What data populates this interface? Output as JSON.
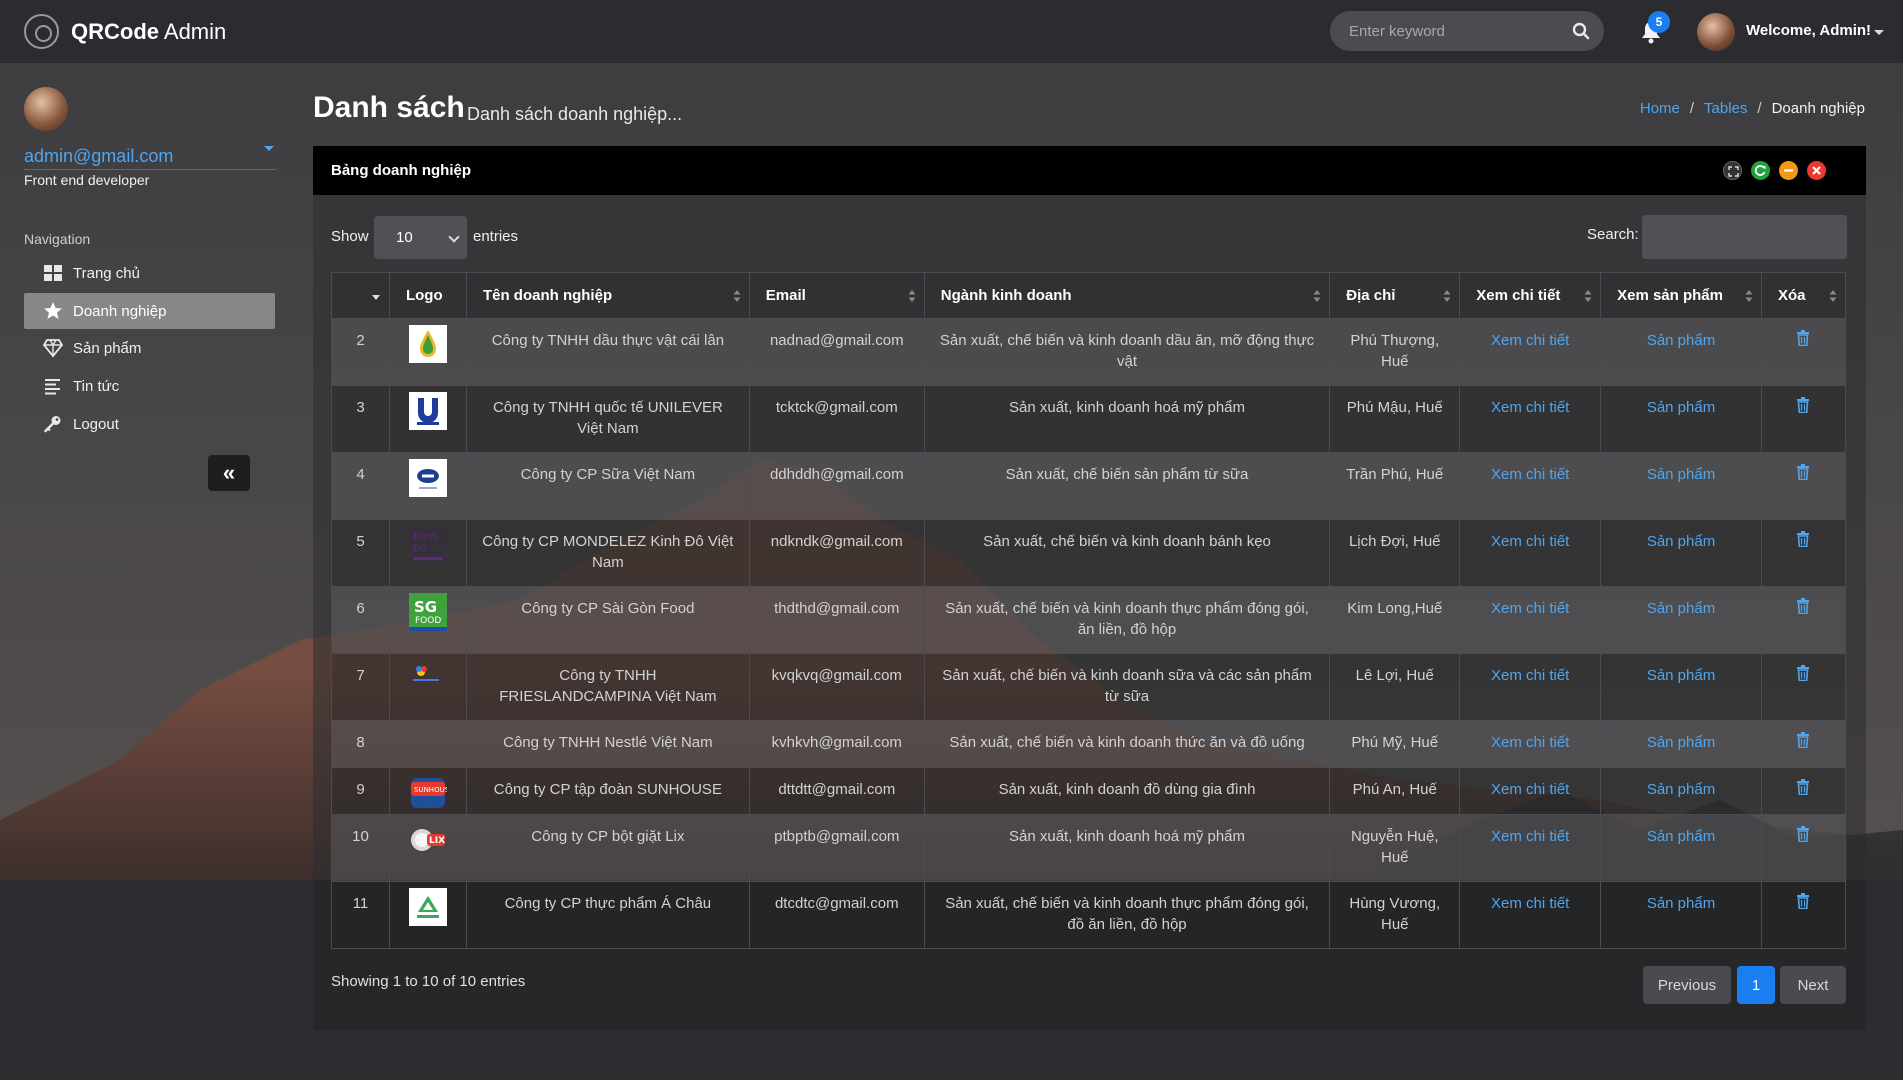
{
  "app": {
    "brand_bold": "QRCode",
    "brand_light": " Admin"
  },
  "header": {
    "search_placeholder": "Enter keyword",
    "notification_count": "5",
    "welcome": "Welcome, Admin!"
  },
  "sidebar": {
    "email": "admin@gmail.com",
    "role": "Front end developer",
    "nav_title": "Navigation",
    "items": [
      {
        "label": "Trang chủ",
        "icon": "grid-icon"
      },
      {
        "label": "Doanh nghiệp",
        "icon": "star-icon",
        "active": true
      },
      {
        "label": "Sản phẩm",
        "icon": "diamond-icon"
      },
      {
        "label": "Tin tức",
        "icon": "list-icon"
      },
      {
        "label": "Logout",
        "icon": "key-icon"
      }
    ],
    "collapse_label": "«"
  },
  "page": {
    "title": "Danh sách",
    "subtitle": "Danh sách doanh nghiệp...",
    "breadcrumb": [
      "Home",
      "Tables",
      "Doanh nghiệp"
    ]
  },
  "panel": {
    "title": "Bảng doanh nghiệp",
    "show_label": "Show",
    "entries_value": "10",
    "entries_label": "entries",
    "search_label": "Search:",
    "columns": [
      "Logo",
      "Tên doanh nghiệp",
      "Email",
      "Ngành kinh doanh",
      "Địa chỉ",
      "Xem chi tiết",
      "Xem sản phẩm",
      "Xóa"
    ],
    "rows": [
      {
        "id": "2",
        "name": "Công ty TNHH dầu thực vật cái lân",
        "email": "nadnad@gmail.com",
        "industry": "Sản xuất, chế biến và kinh doanh dầu ăn, mỡ động thực vật",
        "address": "Phú Thượng, Huế",
        "detail": "Xem chi tiết",
        "products": "Sản phẩm",
        "logo": "oil-drop-logo"
      },
      {
        "id": "3",
        "name": "Công ty TNHH quốc tế UNILEVER Việt Nam",
        "email": "tcktck@gmail.com",
        "industry": "Sản xuất, kinh doanh hoá mỹ phẩm",
        "address": "Phú Mậu, Huế",
        "detail": "Xem chi tiết",
        "products": "Sản phẩm",
        "logo": "unilever-logo"
      },
      {
        "id": "4",
        "name": "Công ty CP Sữa Việt Nam",
        "email": "ddhddh@gmail.com",
        "industry": "Sản xuất, chế biến sản phẩm từ sữa",
        "address": "Trần Phú, Huế",
        "detail": "Xem chi tiết",
        "products": "Sản phẩm",
        "logo": "vinamilk-logo"
      },
      {
        "id": "5",
        "name": "Công ty CP MONDELEZ Kinh Đô Việt Nam",
        "email": "ndkndk@gmail.com",
        "industry": "Sản xuất, chế biến và kinh doanh bánh kẹo",
        "address": "Lịch Đợi, Huế",
        "detail": "Xem chi tiết",
        "products": "Sản phẩm",
        "logo": "mondelez-logo"
      },
      {
        "id": "6",
        "name": "Công ty CP Sài Gòn Food",
        "email": "thdthd@gmail.com",
        "industry": "Sản xuất, chế biến và kinh doanh thực phẩm đóng gói, ăn liền, đồ hộp",
        "address": "Kim Long,Huế",
        "detail": "Xem chi tiết",
        "products": "Sản phẩm",
        "logo": "sgfood-logo"
      },
      {
        "id": "7",
        "name": "Công ty TNHH FRIESLANDCAMPINA Việt Nam",
        "email": "kvqkvq@gmail.com",
        "industry": "Sản xuất, chế biến và kinh doanh sữa và các sản phẩm từ sữa",
        "address": "Lê Lợi, Huế",
        "detail": "Xem chi tiết",
        "products": "Sản phẩm",
        "logo": "frieslandcampina-logo"
      },
      {
        "id": "8",
        "name": "Công ty TNHH Nestlé Việt Nam",
        "email": "kvhkvh@gmail.com",
        "industry": "Sản xuất, chế biến và kinh doanh thức ăn và đồ uống",
        "address": "Phú Mỹ, Huế",
        "detail": "Xem chi tiết",
        "products": "Sản phẩm",
        "logo": "nestle-logo"
      },
      {
        "id": "9",
        "name": "Công ty CP tập đoàn SUNHOUSE",
        "email": "dttdtt@gmail.com",
        "industry": "Sản xuất, kinh doanh đồ dùng gia đình",
        "address": "Phú An, Huế",
        "detail": "Xem chi tiết",
        "products": "Sản phẩm",
        "logo": "sunhouse-logo"
      },
      {
        "id": "10",
        "name": "Công ty CP bột giặt Lix",
        "email": "ptbptb@gmail.com",
        "industry": "Sản xuất, kinh doanh hoá mỹ phẩm",
        "address": "Nguyễn Huệ, Huế",
        "detail": "Xem chi tiết",
        "products": "Sản phẩm",
        "logo": "lix-logo"
      },
      {
        "id": "11",
        "name": "Công ty CP thực phẩm Á Châu",
        "email": "dtcdtc@gmail.com",
        "industry": "Sản xuất, chế biến và kinh doanh thực phẩm đóng gói, đồ ăn liền, đồ hộp",
        "address": "Hùng Vương, Huế",
        "detail": "Xem chi tiết",
        "products": "Sản phẩm",
        "logo": "achau-logo"
      }
    ],
    "showing": "Showing 1 to 10 of 10 entries",
    "pagination": {
      "previous": "Previous",
      "current": "1",
      "next": "Next"
    }
  },
  "colors": {
    "accent": "#1a7ef0",
    "link": "#4fa6ee",
    "panel_head": "#000000",
    "green_btn": "#1fa33b",
    "orange_btn": "#f29a14",
    "red_btn": "#e63b2e"
  }
}
